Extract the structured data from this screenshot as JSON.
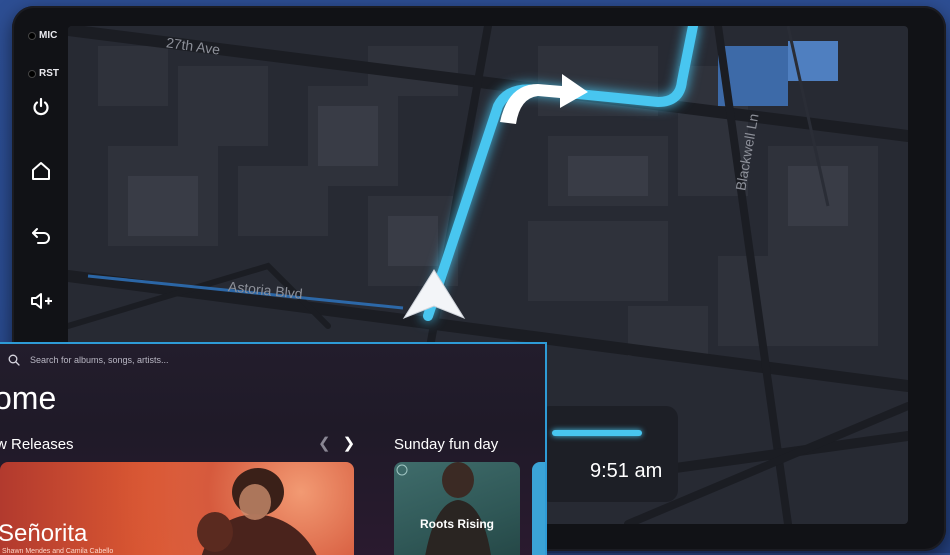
{
  "device": {
    "side_labels": {
      "mic": "MIC",
      "rst": "RST"
    },
    "side_buttons": [
      "power-icon",
      "home-icon",
      "back-icon",
      "volume-up-icon"
    ]
  },
  "map": {
    "streets": {
      "avenue_27th": "27th Ave",
      "blackwell": "Blackwell Ln",
      "astoria": "Astoria Blvd"
    },
    "route_color": "#48c6f0",
    "eta_time": "9:51 am"
  },
  "music": {
    "search_placeholder": "Search for albums, songs, artists...",
    "page_title": "ome",
    "new_releases_title": "w Releases",
    "featured": {
      "title": "Señorita",
      "subtitle": "Shawn Mendes and Camila Cabello"
    },
    "playlist_title": "Sunday fun day",
    "playlist_card": "Roots Rising",
    "accent": "#2e9bd6"
  }
}
